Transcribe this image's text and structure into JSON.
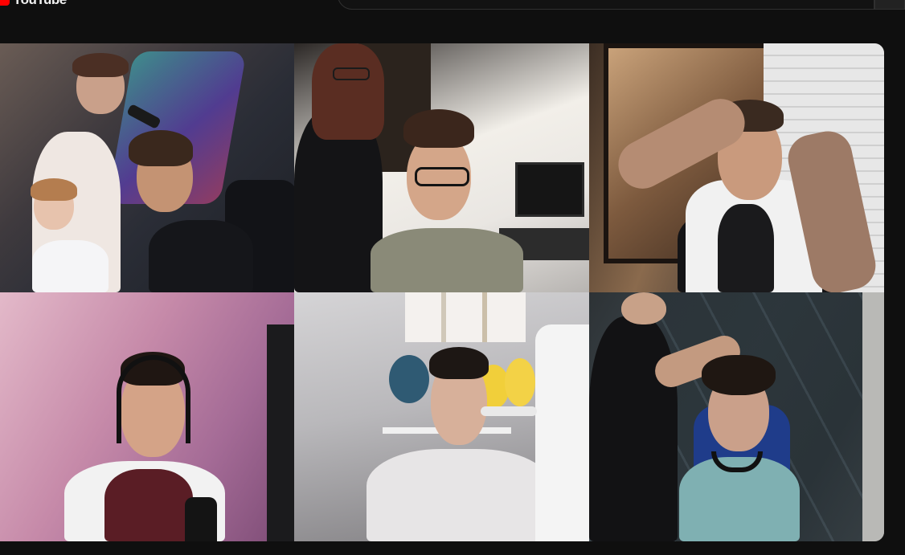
{
  "header": {
    "logo_text": "YouTube",
    "brand_color": "#ff0000",
    "search_placeholder": ""
  },
  "player": {
    "tiles": [
      {
        "name": "tile-1"
      },
      {
        "name": "tile-2"
      },
      {
        "name": "tile-3"
      },
      {
        "name": "tile-4"
      },
      {
        "name": "tile-5"
      },
      {
        "name": "tile-6"
      }
    ]
  }
}
